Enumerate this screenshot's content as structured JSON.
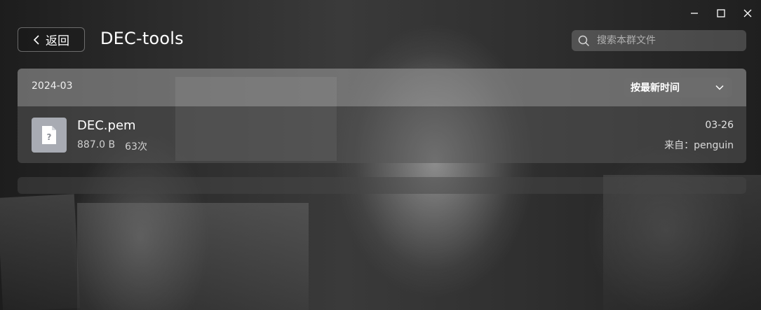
{
  "window": {
    "controls": [
      {
        "name": "minimize-icon"
      },
      {
        "name": "maximize-icon"
      },
      {
        "name": "close-icon"
      }
    ]
  },
  "header": {
    "back_label": "返回",
    "title": "DEC-tools"
  },
  "search": {
    "placeholder": "搜索本群文件",
    "value": ""
  },
  "group": {
    "date": "2024-03",
    "sort_label": "按最新时间"
  },
  "files": [
    {
      "icon": "unknown-file-icon",
      "icon_glyph": "?",
      "name": "DEC.pem",
      "size": "887.0 B",
      "downloads": "63次",
      "date": "03-26",
      "source": "来自：penguin"
    }
  ],
  "colors": {
    "accent": "#ffffff",
    "file_icon_bg": "#a8abb3"
  }
}
